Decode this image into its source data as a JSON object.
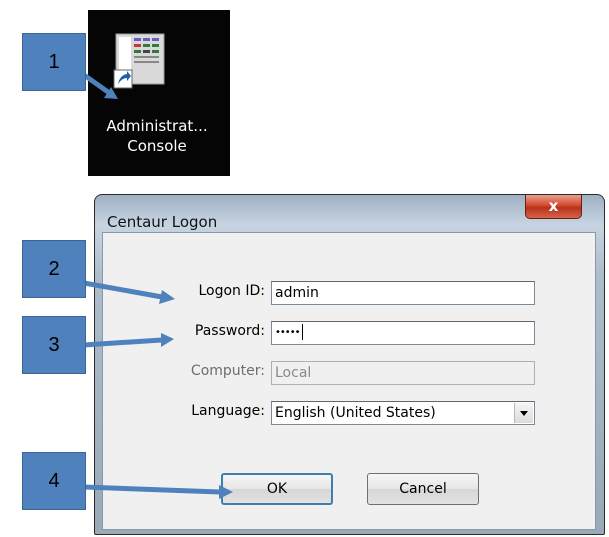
{
  "desktop_shortcut": {
    "label_line1": "Administrat...",
    "label_line2": "Console"
  },
  "dialog": {
    "title": "Centaur Logon",
    "close_glyph": "x",
    "fields": {
      "logon_id": {
        "label": "Logon ID:",
        "value": "admin"
      },
      "password": {
        "label": "Password:",
        "value": "•••••"
      },
      "computer": {
        "label": "Computer:",
        "value": "Local"
      },
      "language": {
        "label": "Language:",
        "value": "English (United States)"
      }
    },
    "ok_label": "OK",
    "cancel_label": "Cancel"
  },
  "callouts": [
    "1",
    "2",
    "3",
    "4"
  ],
  "colors": {
    "callout_fill": "#4f81bd",
    "close_button": "#c9432a",
    "dialog_client": "#f0f0f0"
  }
}
